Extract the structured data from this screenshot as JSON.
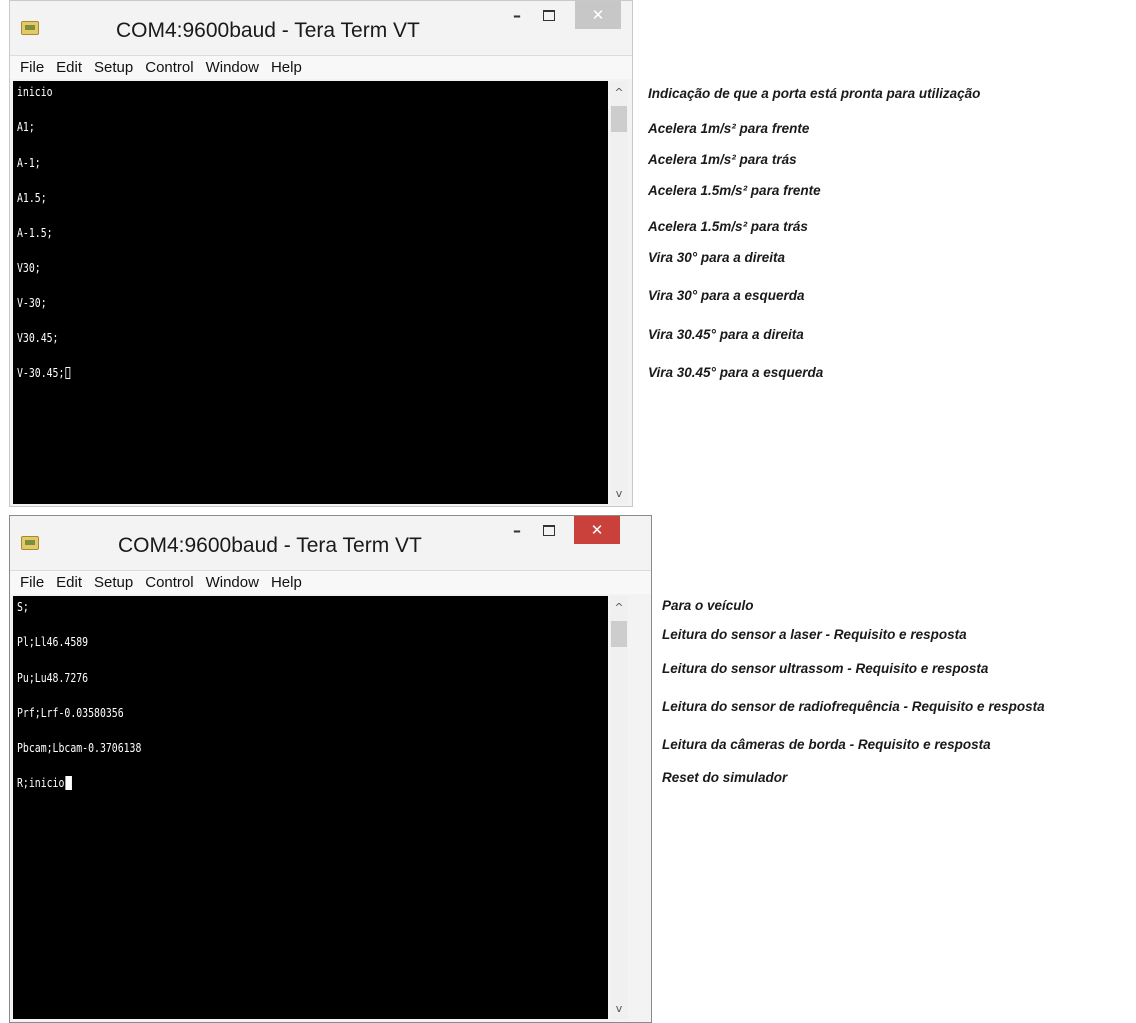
{
  "window1": {
    "title": "COM4:9600baud - Tera Term VT",
    "menu": [
      "File",
      "Edit",
      "Setup",
      "Control",
      "Window",
      "Help"
    ],
    "lines": [
      "inicio",
      "A1;",
      "A-1;",
      "A1.5;",
      "A-1.5;",
      "V30;",
      "V-30;",
      "V30.45;",
      "V-30.45;"
    ],
    "scroll_up": "^",
    "scroll_down": "v"
  },
  "window2": {
    "title": "COM4:9600baud - Tera Term VT",
    "menu": [
      "File",
      "Edit",
      "Setup",
      "Control",
      "Window",
      "Help"
    ],
    "lines": [
      "S;",
      "Pl;Ll46.4589",
      "Pu;Lu48.7276",
      "Prf;Lrf-0.03580356",
      "Pbcam;Lbcam-0.3706138",
      "R;inicio"
    ],
    "scroll_up": "^",
    "scroll_down": "v"
  },
  "annotations1": [
    "Indicação de que a porta está pronta para utilização",
    "Acelera 1m/s² para frente",
    "Acelera 1m/s² para trás",
    "Acelera 1.5m/s² para frente",
    "Acelera 1.5m/s² para trás",
    "Vira 30° para a direita",
    "Vira 30° para a esquerda",
    "Vira 30.45° para a direita",
    "Vira 30.45° para a esquerda"
  ],
  "annotations2": [
    "Para o veículo",
    "Leitura do sensor a laser - Requisito e resposta",
    "Leitura do sensor ultrassom - Requisito e resposta",
    "Leitura do sensor de radiofrequência - Requisito e resposta",
    "Leitura da câmeras de borda - Requisito e resposta",
    "Reset do simulador"
  ],
  "icons": {
    "app": "teraterm-app-icon",
    "minimize": "minimize-icon",
    "maximize": "maximize-icon",
    "close": "close-icon"
  },
  "colors": {
    "terminal_bg": "#000000",
    "terminal_fg": "#ffffff",
    "close_active": "#c9413a",
    "close_inactive": "#c7c7c7"
  }
}
